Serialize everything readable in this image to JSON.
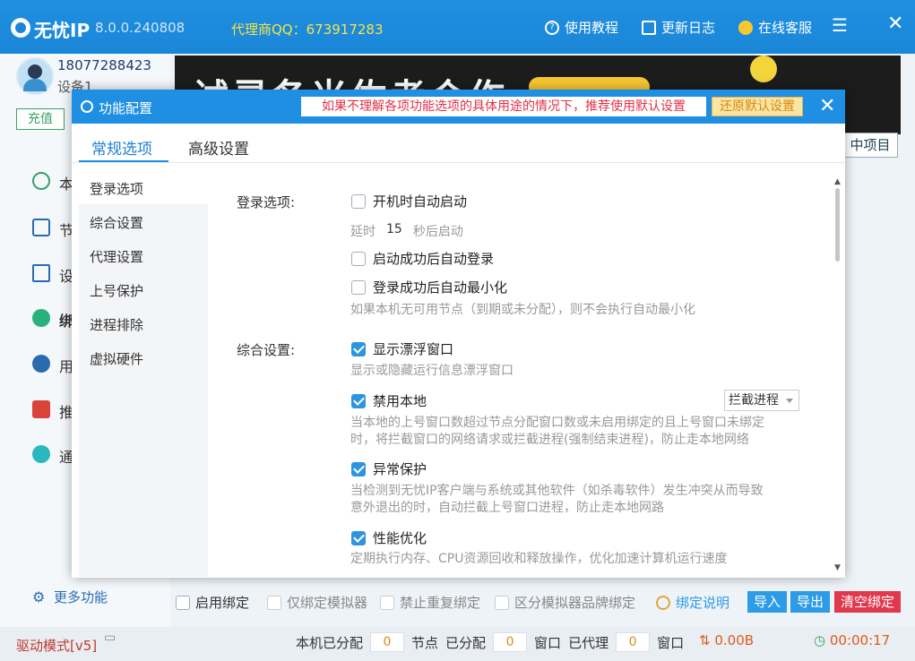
{
  "titlebar": {
    "app_name": "无忧IP",
    "version": "8.0.0.240808",
    "agent": "代理商QQ：673917283",
    "help": "使用教程",
    "changelog": "更新日志",
    "service": "在线客服",
    "menu_icon": "hamburger-icon",
    "close_icon": "close-icon"
  },
  "sidebar": {
    "phone": "18077288423",
    "device": "设备1",
    "recharge": "充值",
    "items": [
      {
        "label": "本",
        "icon": "play-icon",
        "color": "#3aa06a"
      },
      {
        "label": "节",
        "icon": "tree-icon",
        "color": "#2a6bb0"
      },
      {
        "label": "设",
        "icon": "laptop-icon",
        "color": "#2a6bb0"
      },
      {
        "label": "绑",
        "icon": "bind-icon",
        "color": "#2ab07a"
      },
      {
        "label": "用",
        "icon": "user-icon",
        "color": "#2a6bb0"
      },
      {
        "label": "推",
        "icon": "gift-icon",
        "color": "#d9443a"
      },
      {
        "label": "通",
        "icon": "bell-icon",
        "color": "#2ab8c0"
      }
    ],
    "more": "更多功能"
  },
  "banner": {
    "text": "试灵各米佐考合作",
    "tab_label": "中项目"
  },
  "dialog": {
    "title": "功能配置",
    "warning": "如果不理解各项功能选项的具体用途的情况下，推荐使用默认设置",
    "reset": "还原默认设置",
    "tabs": [
      "常规选项",
      "高级设置"
    ],
    "nav": [
      "登录选项",
      "综合设置",
      "代理设置",
      "上号保护",
      "进程排除",
      "虚拟硬件"
    ],
    "login_section": "登录选项:",
    "general_section": "综合设置:",
    "options": {
      "autostart": {
        "label": "开机时自动启动",
        "checked": false
      },
      "delay_prefix": "延时",
      "delay_value": "15",
      "delay_suffix": "秒后启动",
      "autologin": {
        "label": "启动成功后自动登录",
        "checked": false
      },
      "autominimize": {
        "label": "登录成功后自动最小化",
        "checked": false
      },
      "autominimize_desc": "如果本机无可用节点（到期或未分配），则不会执行自动最小化",
      "floatwin": {
        "label": "显示漂浮窗口",
        "checked": true
      },
      "floatwin_desc": "显示或隐藏运行信息漂浮窗口",
      "disable_local": {
        "label": "禁用本地",
        "checked": true
      },
      "disable_local_select": "拦截进程",
      "disable_local_desc1": "当本地的上号窗口数超过节点分配窗口数或未启用绑定的且上号窗口未绑定",
      "disable_local_desc2": "时，将拦截窗口的网络请求或拦截进程(强制结束进程)，防止走本地网络",
      "exception": {
        "label": "异常保护",
        "checked": true
      },
      "exception_desc1": "当检测到无忧IP客户端与系统或其他软件（如杀毒软件）发生冲突从而导致",
      "exception_desc2": "意外退出的时，自动拦截上号窗口进程，防止走本地网路",
      "perf": {
        "label": "性能优化",
        "checked": true
      },
      "perf_desc": "定期执行内存、CPU资源回收和释放操作，优化加速计算机运行速度"
    }
  },
  "bindbar": {
    "enable_bind": "启用绑定",
    "emulator_only": "仅绑定模拟器",
    "no_dup": "禁止重复绑定",
    "brand": "区分模拟器品牌绑定",
    "help": "绑定说明",
    "import": "导入",
    "export": "导出",
    "clear": "清空绑定"
  },
  "statusbar": {
    "drive": "驱动模式[v5]",
    "allocated_label": "本机已分配",
    "allocated_value": "0",
    "node_label": "节点",
    "assigned_label": "已分配",
    "assigned_value": "0",
    "window_label1": "窗口",
    "proxied_label": "已代理",
    "proxied_value": "0",
    "window_label2": "窗口",
    "speed": "0.00B",
    "timer": "00:00:17"
  }
}
